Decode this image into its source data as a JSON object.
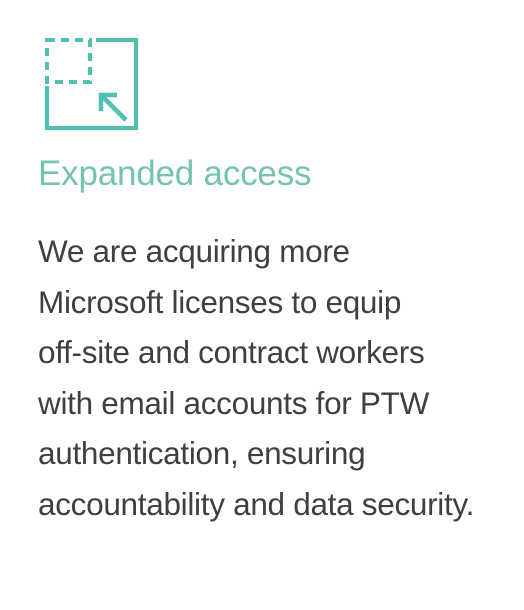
{
  "colors": {
    "accent": "#4fc0b2",
    "heading": "#76c2b3",
    "body_text": "#3f3f3f",
    "background": "#ffffff"
  },
  "card": {
    "icon": "expand-arrow-dashed-square-icon",
    "title": "Expanded access",
    "description_lines": [
      "We are acquiring more",
      "Microsoft licenses to equip",
      "off-site and contract workers",
      "with email accounts for PTW",
      "authentication, ensuring",
      "accountability and data security."
    ]
  }
}
